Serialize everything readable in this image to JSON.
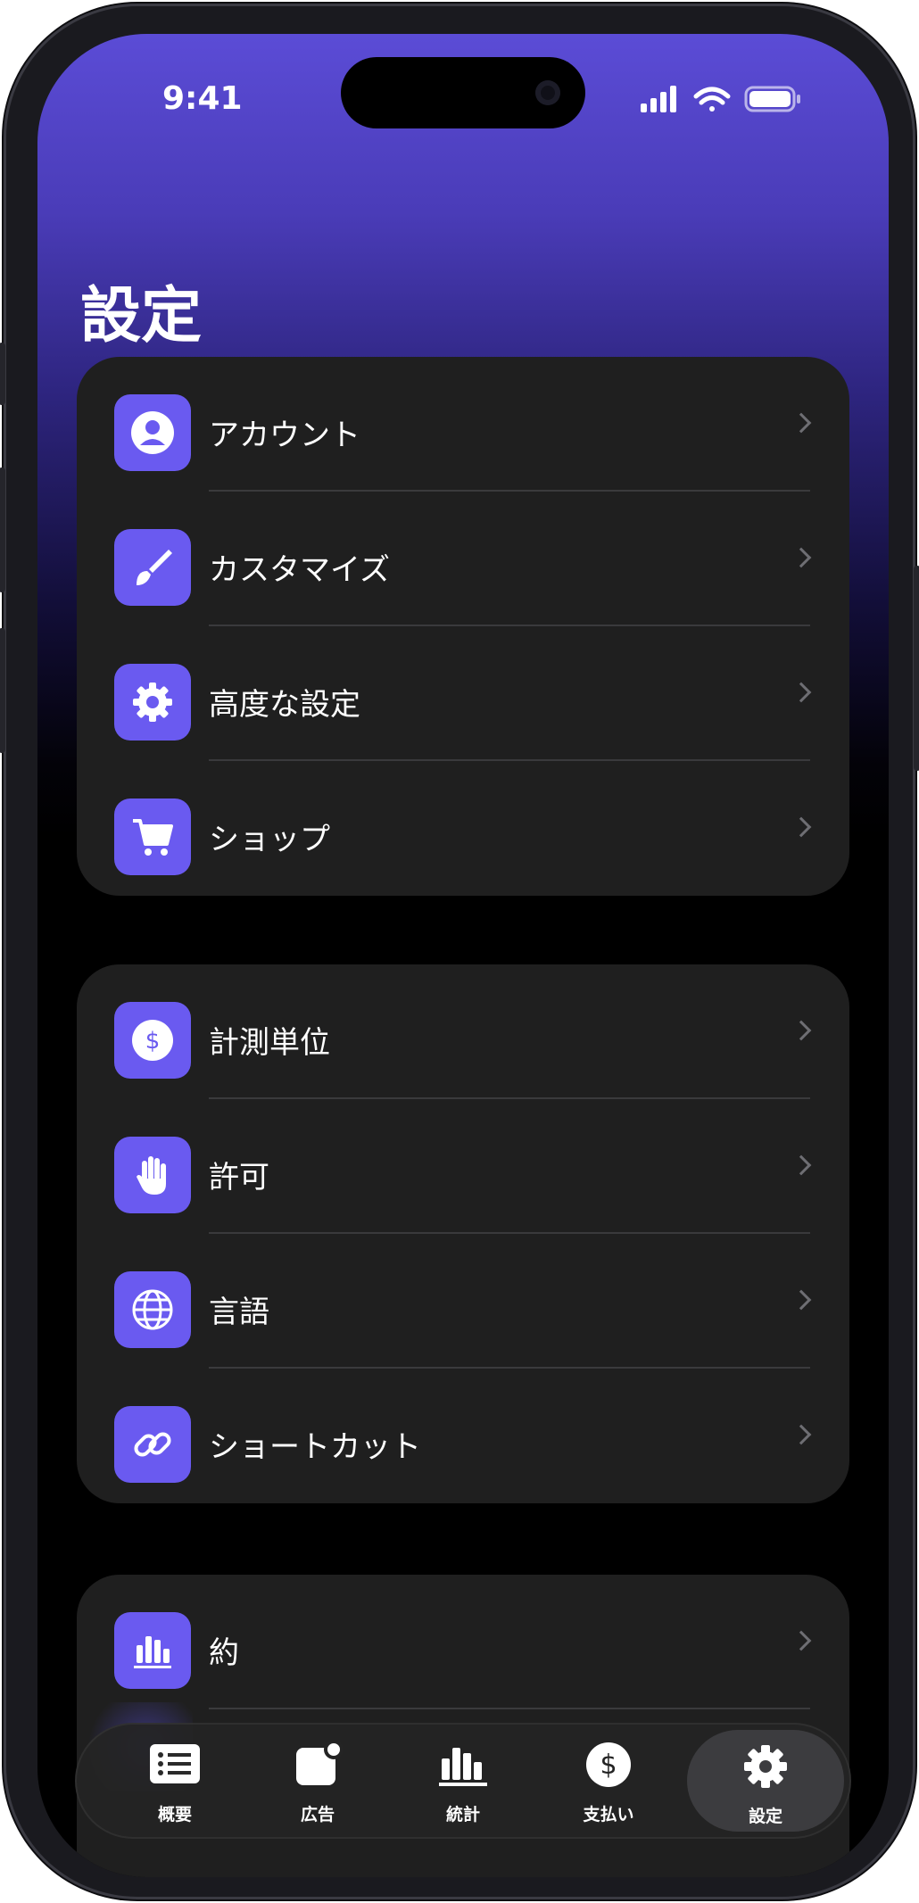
{
  "status_bar": {
    "time": "9:41"
  },
  "page": {
    "title": "設定"
  },
  "groups": [
    {
      "items": [
        {
          "label": "アカウント",
          "icon": "person-circle-icon"
        },
        {
          "label": "カスタマイズ",
          "icon": "paintbrush-icon"
        },
        {
          "label": "高度な設定",
          "icon": "gear-icon"
        },
        {
          "label": "ショップ",
          "icon": "cart-icon"
        }
      ]
    },
    {
      "items": [
        {
          "label": "計測単位",
          "icon": "dollar-circle-icon"
        },
        {
          "label": "許可",
          "icon": "hand-icon"
        },
        {
          "label": "言語",
          "icon": "globe-icon"
        },
        {
          "label": "ショートカット",
          "icon": "link-icon"
        }
      ]
    },
    {
      "items": [
        {
          "label": "約",
          "icon": "bar-chart-icon"
        }
      ]
    }
  ],
  "tab_bar": {
    "tabs": [
      {
        "label": "概要",
        "icon": "list-icon"
      },
      {
        "label": "広告",
        "icon": "badge-square-icon"
      },
      {
        "label": "統計",
        "icon": "bar-chart-icon"
      },
      {
        "label": "支払い",
        "icon": "dollar-circle-icon"
      },
      {
        "label": "設定",
        "icon": "gear-icon",
        "active": true
      }
    ]
  },
  "colors": {
    "accent": "#6a5af0",
    "card": "#1f1f1f",
    "header_gradient_top": "#5b4cd6"
  }
}
